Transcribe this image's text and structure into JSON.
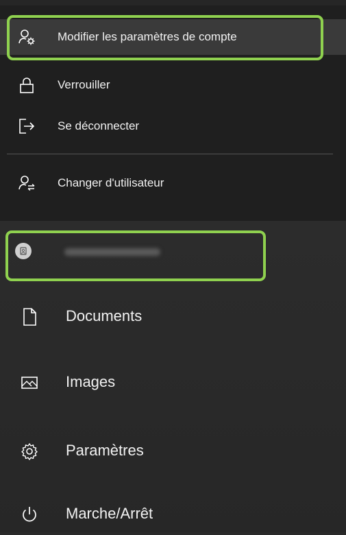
{
  "account_flyout": {
    "items": [
      {
        "label": "Modifier les paramètres de compte",
        "icon": "user-gear-icon"
      },
      {
        "label": "Verrouiller",
        "icon": "lock-icon"
      },
      {
        "label": "Se déconnecter",
        "icon": "sign-out-icon"
      },
      {
        "label": "Changer d'utilisateur",
        "icon": "switch-user-icon"
      }
    ]
  },
  "start_menu": {
    "user": {
      "avatar_icon": "user-avatar-icon"
    },
    "items": [
      {
        "label": "Documents",
        "icon": "document-icon"
      },
      {
        "label": "Images",
        "icon": "image-icon"
      },
      {
        "label": "Paramètres",
        "icon": "gear-icon"
      },
      {
        "label": "Marche/Arrêt",
        "icon": "power-icon"
      }
    ]
  },
  "colors": {
    "highlight": "#8fd14f",
    "flyout_bg": "#1f1f1f",
    "menu_bg": "#2a2a2a"
  }
}
